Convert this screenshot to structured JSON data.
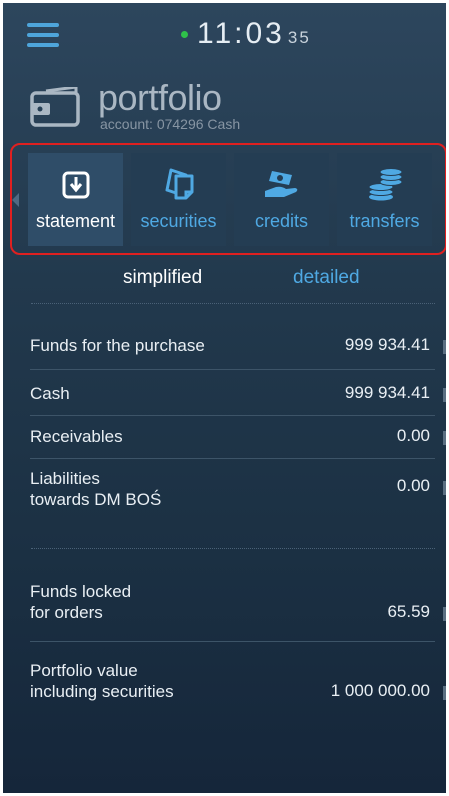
{
  "status": {
    "time_main": "11:03",
    "time_seconds": "35"
  },
  "portfolio": {
    "title": "portfolio",
    "account": "account: 074296 Cash"
  },
  "tabs": [
    {
      "label": "statement",
      "icon": "download-icon",
      "active": true
    },
    {
      "label": "securities",
      "icon": "documents-icon",
      "active": false
    },
    {
      "label": "credits",
      "icon": "hand-money-icon",
      "active": false
    },
    {
      "label": "transfers",
      "icon": "coins-icon",
      "active": false
    }
  ],
  "view_toggle": {
    "simplified": "simplified",
    "detailed": "detailed",
    "active": "simplified"
  },
  "rows": [
    {
      "label": "Funds for the purchase",
      "value": "999 934.41"
    },
    {
      "label": "Cash",
      "value": "999 934.41"
    },
    {
      "label": "Receivables",
      "value": "0.00"
    },
    {
      "label_line1": "Liabilities",
      "label_line2": "towards DM BOŚ",
      "value": "0.00"
    },
    {
      "label_line1": "Funds locked",
      "label_line2": "for orders",
      "value": "65.59"
    },
    {
      "label_line1": "Portfolio value",
      "label_line2": "including securities",
      "value": "1 000 000.00"
    }
  ],
  "colors": {
    "accent": "#4fa9e3",
    "active_dot": "#2fc14a",
    "highlight_frame": "#e02020"
  }
}
